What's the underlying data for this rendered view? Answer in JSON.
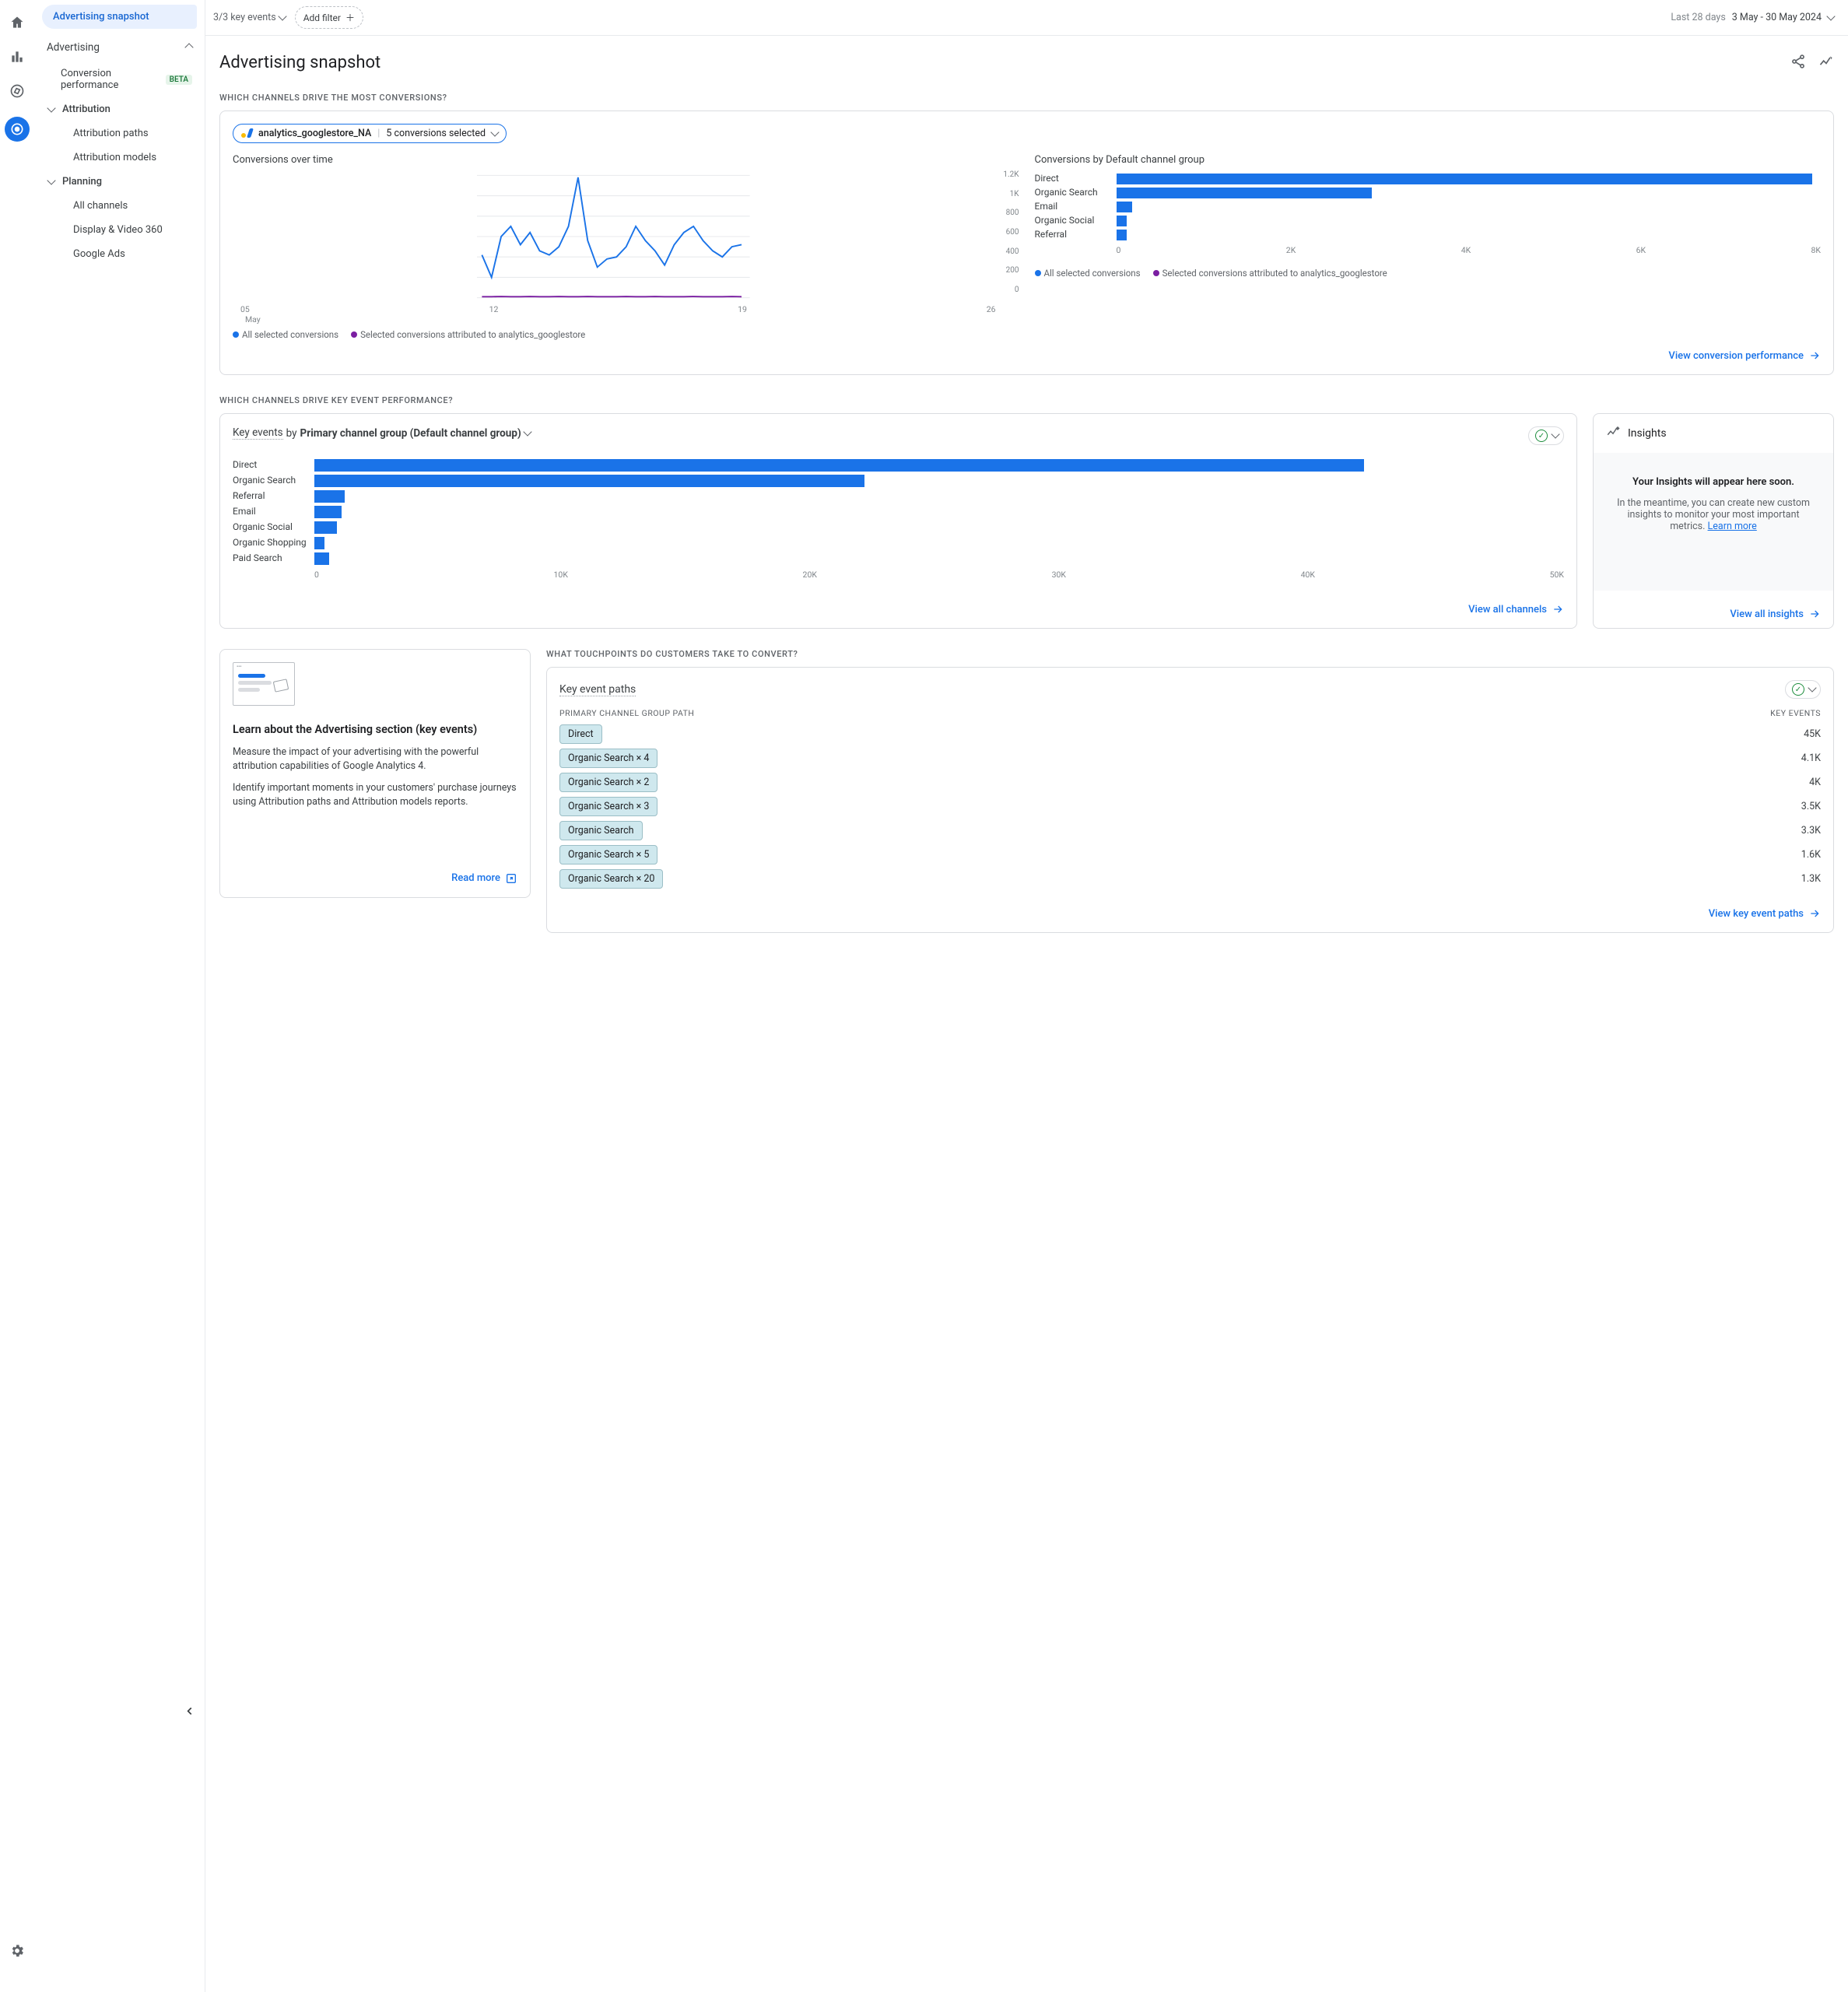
{
  "rail": {
    "items": [
      "home",
      "reports",
      "explore",
      "advertising",
      "settings"
    ]
  },
  "sidebar": {
    "top_pill": "Advertising snapshot",
    "group_label": "Advertising",
    "conv_perf": "Conversion performance",
    "conv_perf_badge": "BETA",
    "attribution": "Attribution",
    "attr_paths": "Attribution paths",
    "attr_models": "Attribution models",
    "planning": "Planning",
    "all_channels": "All channels",
    "dv360": "Display & Video 360",
    "gads": "Google Ads"
  },
  "topbar": {
    "kev": "3/3 key events",
    "add_filter": "Add filter",
    "last": "Last 28 days",
    "range": "3 May - 30 May 2024"
  },
  "page_title": "Advertising snapshot",
  "sect1_label": "WHICH CHANNELS DRIVE THE MOST CONVERSIONS?",
  "src_pill": {
    "name": "analytics_googlestore_NA",
    "count": "5 conversions selected"
  },
  "conv_time_title": "Conversions over time",
  "conv_group_title": "Conversions by Default channel group",
  "legend_a": "All selected conversions",
  "legend_b": "Selected conversions attributed to analytics_googlestore",
  "link_conv_perf": "View conversion performance",
  "chart_data": [
    {
      "type": "line",
      "title": "Conversions over time",
      "ylim": [
        0,
        1200
      ],
      "yticks": [
        "0",
        "200",
        "400",
        "600",
        "800",
        "1K",
        "1.2K"
      ],
      "x_ticks": [
        "05",
        "12",
        "19",
        "26"
      ],
      "x_month": "May",
      "series": [
        {
          "name": "All selected conversions",
          "color": "#1a73e8",
          "values": [
            420,
            200,
            600,
            700,
            520,
            640,
            460,
            420,
            500,
            700,
            1180,
            560,
            300,
            380,
            400,
            500,
            700,
            560,
            460,
            320,
            520,
            640,
            700,
            560,
            460,
            400,
            500,
            520
          ]
        },
        {
          "name": "Selected conversions attributed to analytics_googlestore",
          "color": "#7b1fa2",
          "values": [
            10,
            10,
            12,
            10,
            10,
            12,
            10,
            10,
            12,
            10,
            10,
            12,
            10,
            10,
            10,
            12,
            10,
            10,
            12,
            10,
            10,
            10,
            12,
            10,
            10,
            10,
            12,
            10
          ]
        }
      ]
    },
    {
      "type": "bar",
      "title": "Conversions by Default channel group",
      "xlim": [
        0,
        8000
      ],
      "xticks": [
        "0",
        "2K",
        "4K",
        "6K",
        "8K"
      ],
      "categories": [
        "Direct",
        "Organic Search",
        "Email",
        "Organic Social",
        "Referral"
      ],
      "values": [
        7900,
        2900,
        180,
        120,
        120
      ]
    },
    {
      "type": "bar",
      "title": "Key events by Primary channel group (Default channel group)",
      "xlim": [
        0,
        50000
      ],
      "xticks": [
        "0",
        "10K",
        "20K",
        "30K",
        "40K",
        "50K"
      ],
      "categories": [
        "Direct",
        "Organic Search",
        "Referral",
        "Email",
        "Organic Social",
        "Organic Shopping",
        "Paid Search"
      ],
      "values": [
        42000,
        22000,
        1200,
        1100,
        900,
        400,
        600
      ]
    }
  ],
  "sect2_label": "WHICH CHANNELS DRIVE KEY EVENT PERFORMANCE?",
  "ke_title_a": "Key events",
  "ke_title_b": " by ",
  "ke_title_c": "Primary channel group (Default channel group)",
  "link_all_channels": "View all channels",
  "insights": {
    "title": "Insights",
    "h": "Your Insights will appear here soon.",
    "p": "In the meantime, you can create new custom insights to monitor your most important metrics.",
    "learn": "Learn more",
    "link": "View all insights"
  },
  "sect3_label": "WHAT TOUCHPOINTS DO CUSTOMERS TAKE TO CONVERT?",
  "learn": {
    "h": "Learn about the Advertising section (key events)",
    "p1": "Measure the impact of your advertising with the powerful attribution capabilities of Google Analytics 4.",
    "p2": "Identify important moments in your customers' purchase journeys using Attribution paths and Attribution models reports.",
    "link": "Read more"
  },
  "paths": {
    "title": "Key event paths",
    "col1": "PRIMARY CHANNEL GROUP PATH",
    "col2": "KEY EVENTS",
    "rows": [
      {
        "chip": "Direct",
        "val": "45K"
      },
      {
        "chip": "Organic Search × 4",
        "val": "4.1K"
      },
      {
        "chip": "Organic Search × 2",
        "val": "4K"
      },
      {
        "chip": "Organic Search × 3",
        "val": "3.5K"
      },
      {
        "chip": "Organic Search",
        "val": "3.3K"
      },
      {
        "chip": "Organic Search × 5",
        "val": "1.6K"
      },
      {
        "chip": "Organic Search × 20",
        "val": "1.3K"
      }
    ],
    "link": "View key event paths"
  }
}
